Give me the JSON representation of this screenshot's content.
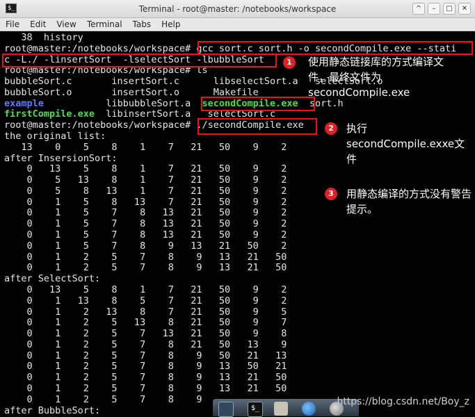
{
  "window": {
    "title": "Terminal - root@master: /notebooks/workspace",
    "menu": [
      "File",
      "Edit",
      "View",
      "Terminal",
      "Tabs",
      "Help"
    ]
  },
  "terminal": {
    "lines": [
      {
        "segs": [
          {
            "t": "   38  history"
          }
        ]
      },
      {
        "segs": [
          {
            "t": "root@master:/notebooks/workspace# gcc sort.c sort.h -o secondCompile.exe --stati"
          }
        ]
      },
      {
        "segs": [
          {
            "t": "c -L./ -linsertSort  -lselectSort -lbubbleSort"
          }
        ]
      },
      {
        "segs": [
          {
            "t": "root@master:/notebooks/workspace# ls"
          }
        ]
      },
      {
        "segs": [
          {
            "t": "bubbleSort.c       insertSort.c      libselectSort.a   selectSort.o"
          }
        ]
      },
      {
        "segs": [
          {
            "t": "bubbleSort.o       insertSort.o      Makefile"
          }
        ]
      },
      {
        "segs": [
          {
            "t": "example",
            "c": "dir"
          },
          {
            "t": "           libbubbleSort.a  "
          },
          {
            "t": "secondCompile.exe",
            "c": "exec"
          },
          {
            "t": "  sort.h"
          }
        ]
      },
      {
        "segs": [
          {
            "t": "firstCompile.exe",
            "c": "exec"
          },
          {
            "t": "  libinsertSort.a   selectSort.c"
          }
        ]
      },
      {
        "segs": [
          {
            "t": "root@master:/notebooks/workspace# ./secondCompile.exe"
          }
        ]
      },
      {
        "segs": [
          {
            "t": "the original list:"
          }
        ]
      },
      {
        "segs": [
          {
            "t": "   13    0    5    8    1    7   21   50    9    2"
          }
        ]
      },
      {
        "segs": [
          {
            "t": "after InsersionSort:"
          }
        ]
      },
      {
        "segs": [
          {
            "t": "    0   13    5    8    1    7   21   50    9    2"
          }
        ]
      },
      {
        "segs": [
          {
            "t": "    0    5   13    8    1    7   21   50    9    2"
          }
        ]
      },
      {
        "segs": [
          {
            "t": "    0    5    8   13    1    7   21   50    9    2"
          }
        ]
      },
      {
        "segs": [
          {
            "t": "    0    1    5    8   13    7   21   50    9    2"
          }
        ]
      },
      {
        "segs": [
          {
            "t": "    0    1    5    7    8   13   21   50    9    2"
          }
        ]
      },
      {
        "segs": [
          {
            "t": "    0    1    5    7    8   13   21   50    9    2"
          }
        ]
      },
      {
        "segs": [
          {
            "t": "    0    1    5    7    8   13   21   50    9    2"
          }
        ]
      },
      {
        "segs": [
          {
            "t": "    0    1    5    7    8    9   13   21   50    2"
          }
        ]
      },
      {
        "segs": [
          {
            "t": "    0    1    2    5    7    8    9   13   21   50"
          }
        ]
      },
      {
        "segs": [
          {
            "t": "    0    1    2    5    7    8    9   13   21   50"
          }
        ]
      },
      {
        "segs": [
          {
            "t": "after SelectSort:"
          }
        ]
      },
      {
        "segs": [
          {
            "t": "    0   13    5    8    1    7   21   50    9    2"
          }
        ]
      },
      {
        "segs": [
          {
            "t": "    0    1   13    8    5    7   21   50    9    2"
          }
        ]
      },
      {
        "segs": [
          {
            "t": "    0    1    2   13    8    7   21   50    9    5"
          }
        ]
      },
      {
        "segs": [
          {
            "t": "    0    1    2    5   13    8   21   50    9    7"
          }
        ]
      },
      {
        "segs": [
          {
            "t": "    0    1    2    5    7   13   21   50    9    8"
          }
        ]
      },
      {
        "segs": [
          {
            "t": "    0    1    2    5    7    8   21   50   13    9"
          }
        ]
      },
      {
        "segs": [
          {
            "t": "    0    1    2    5    7    8    9   50   21   13"
          }
        ]
      },
      {
        "segs": [
          {
            "t": "    0    1    2    5    7    8    9   13   50   21"
          }
        ]
      },
      {
        "segs": [
          {
            "t": "    0    1    2    5    7    8    9   13   21   50"
          }
        ]
      },
      {
        "segs": [
          {
            "t": "    0    1    2    5    7    8    9   13   21   50"
          }
        ]
      },
      {
        "segs": [
          {
            "t": "    0    1    2    5    7    8    9"
          }
        ]
      },
      {
        "segs": [
          {
            "t": "after BubbleSort:"
          }
        ]
      }
    ]
  },
  "annotations": [
    {
      "num": "1",
      "text": "使用静态链接库的方式编译文件，最终文件为secondCompile.exe"
    },
    {
      "num": "2",
      "text": "执行secondCompile.exxe文件"
    },
    {
      "num": "3",
      "text": "用静态编译的方式没有警告提示。"
    }
  ],
  "colors": {
    "highlight_box": "#e11111",
    "executable": "#48e048",
    "directory": "#5c7cff",
    "badge": "#e31f26"
  },
  "watermark": "https://blog.csdn.net/Boy_z"
}
